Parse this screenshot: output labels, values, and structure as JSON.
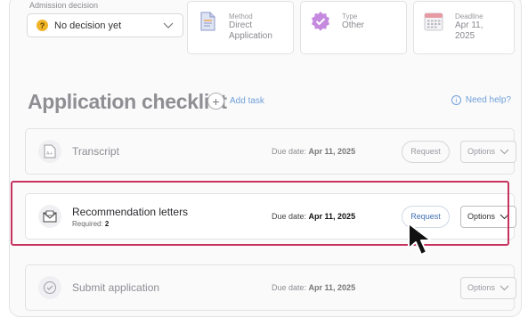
{
  "admission": {
    "label": "Admission decision",
    "decision_value": "No decision yet"
  },
  "cards": {
    "method": {
      "label": "Method",
      "value": "Direct Application"
    },
    "type": {
      "label": "Type",
      "value": "Other"
    },
    "deadline": {
      "label": "Deadline",
      "value": "Apr 11, 2025"
    }
  },
  "checklist": {
    "title": "Application checklist",
    "add_task": "Add task",
    "need_help": "Need help?",
    "items": [
      {
        "name": "Transcript",
        "due_prefix": "Due date: ",
        "due_date": "Apr 11, 2025",
        "request_label": "Request",
        "options_label": "Options"
      },
      {
        "name": "Recommendation letters",
        "required_prefix": "Required: ",
        "required_count": "2",
        "due_prefix": "Due date: ",
        "due_date": "Apr 11, 2025",
        "request_label": "Request",
        "options_label": "Options"
      },
      {
        "name": "Submit application",
        "due_prefix": "Due date: ",
        "due_date": "Apr 11, 2025",
        "options_label": "Options"
      }
    ]
  },
  "colors": {
    "highlight": "#c8325f",
    "link": "#6f9fd8",
    "warning": "#f0b429",
    "type_badge": "#c58ae0",
    "deadline_icon": "#e79aa3"
  },
  "icons": {
    "decision": "question-badge-icon",
    "method": "document-icon",
    "type": "verified-badge-icon",
    "deadline": "calendar-icon",
    "add": "plus-circle-icon",
    "help": "info-icon",
    "transcript": "transcript-icon",
    "letters": "envelope-icon",
    "submit": "checkmark-badge-icon",
    "pointer": "cursor-arrow-icon"
  }
}
